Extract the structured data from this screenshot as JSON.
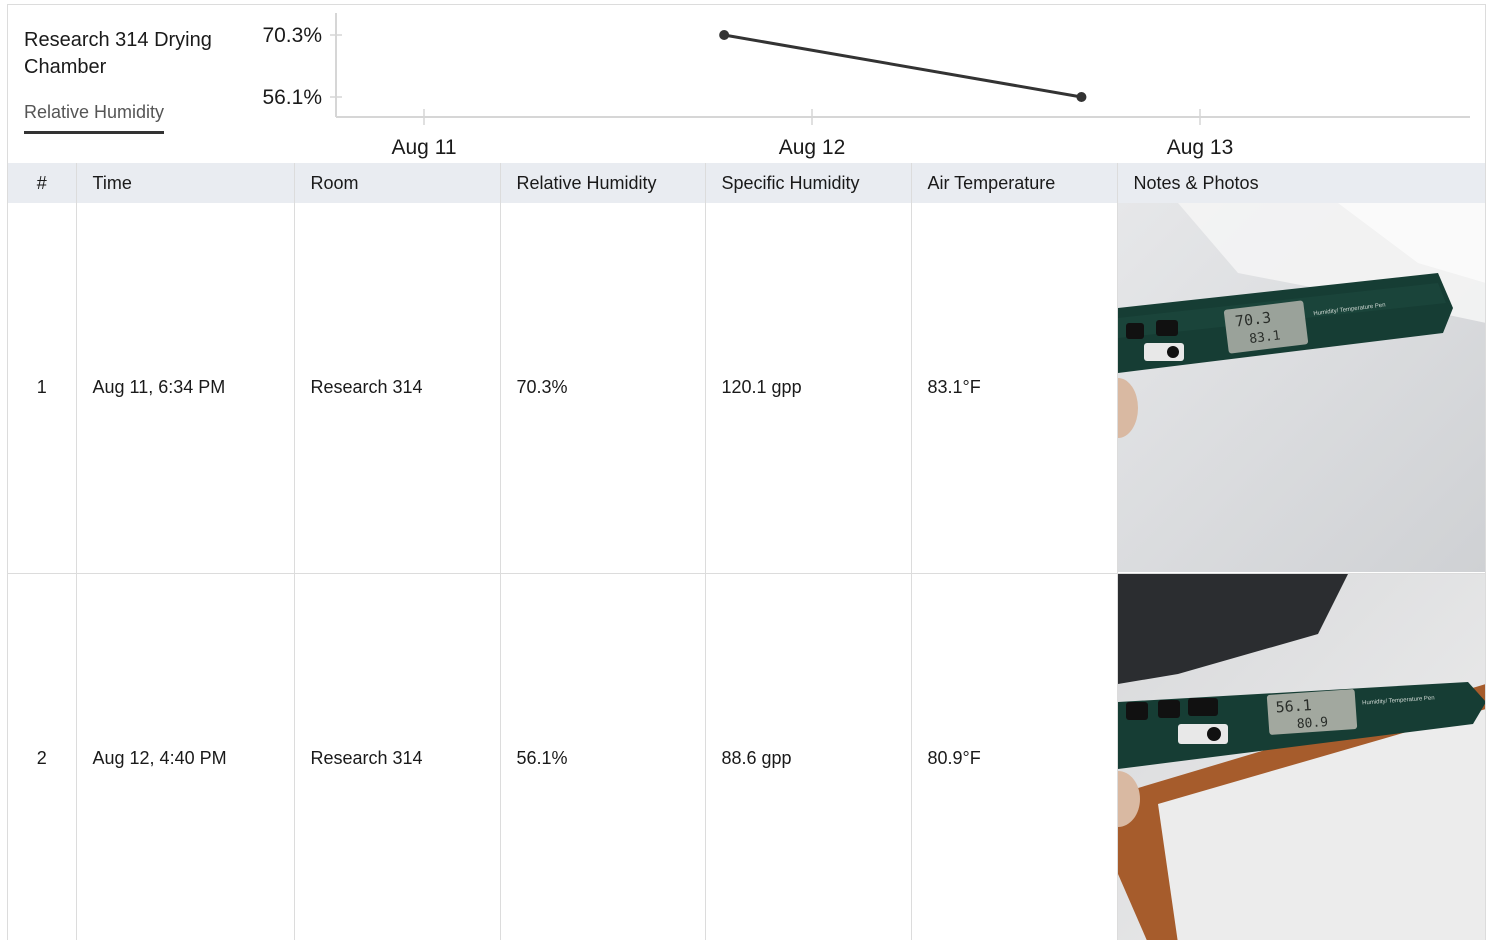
{
  "header": {
    "room_title": "Research 314 Drying Chamber",
    "metric_tab": "Relative Humidity"
  },
  "chart_data": {
    "type": "line",
    "x": [
      "Aug 11, 6:34 PM",
      "Aug 12, 4:40 PM"
    ],
    "y": [
      70.3,
      56.1
    ],
    "y_tick_labels": [
      "70.3%",
      "56.1%"
    ],
    "x_tick_labels": [
      "Aug 11",
      "Aug 12",
      "Aug 13"
    ],
    "color": "#333333"
  },
  "table": {
    "columns": [
      "#",
      "Time",
      "Room",
      "Relative Humidity",
      "Specific Humidity",
      "Air Temperature",
      "Notes & Photos"
    ],
    "rows": [
      {
        "num": "1",
        "time": "Aug 11, 6:34 PM",
        "room": "Research 314",
        "rh": "70.3%",
        "sh": "120.1 gpp",
        "temp": "83.1°F",
        "photo": {
          "display_top": "70.3",
          "display_bottom": "83.1",
          "label": "Humidity/ Temperature Pen"
        }
      },
      {
        "num": "2",
        "time": "Aug 12, 4:40 PM",
        "room": "Research 314",
        "rh": "56.1%",
        "sh": "88.6 gpp",
        "temp": "80.9°F",
        "photo": {
          "display_top": "56.1",
          "display_bottom": "80.9",
          "label": "Humidity/ Temperature Pen"
        }
      }
    ]
  }
}
